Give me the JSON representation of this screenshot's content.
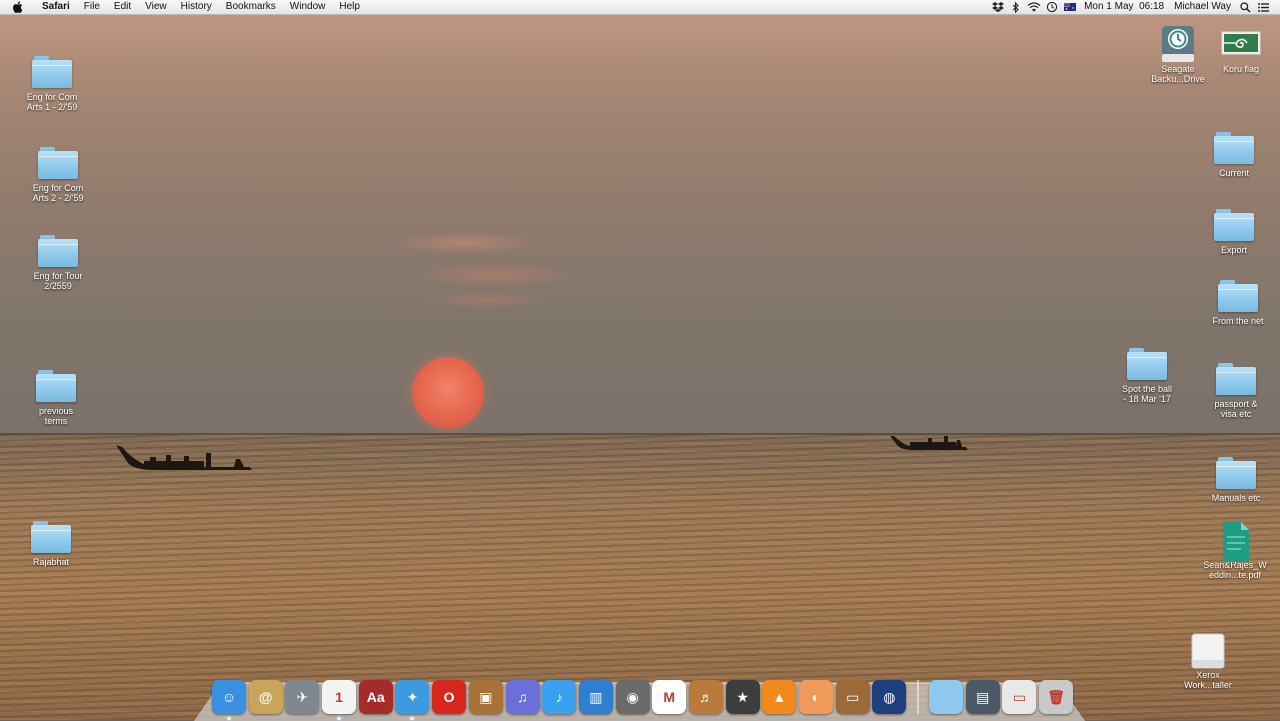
{
  "menubar": {
    "app_name": "Safari",
    "menus": [
      "File",
      "Edit",
      "View",
      "History",
      "Bookmarks",
      "Window",
      "Help"
    ],
    "clock": "Mon 1 May  06:18",
    "user": "Michael Way",
    "status_icons": [
      "dropbox-icon",
      "bluetooth-icon",
      "wifi-icon",
      "time-machine-icon",
      "flag-australia-icon"
    ]
  },
  "desktop_icons_left": [
    {
      "label": "Eng for Com\nArts 1 - 2/'59",
      "kind": "folder"
    },
    {
      "label": "Eng for Com\nArts 2 - 2/'59",
      "kind": "folder"
    },
    {
      "label": "Eng for Tour\n2/2559",
      "kind": "folder"
    },
    {
      "label": "previous\nterms",
      "kind": "folder"
    },
    {
      "label": "Rajabhat",
      "kind": "folder"
    }
  ],
  "desktop_icons_right": [
    {
      "label": "Seagate\nBacku...Drive",
      "kind": "drive"
    },
    {
      "label": "Koru flag",
      "kind": "image"
    },
    {
      "label": "Current",
      "kind": "folder"
    },
    {
      "label": "Export",
      "kind": "folder"
    },
    {
      "label": "From the net",
      "kind": "folder"
    },
    {
      "label": "Spot the ball\n- 18 Mar '17",
      "kind": "folder"
    },
    {
      "label": "passport &\nvisa etc",
      "kind": "folder"
    },
    {
      "label": "Manuals etc",
      "kind": "folder"
    },
    {
      "label": "Sean&Rajes_W\neddin...te.pdf",
      "kind": "pdf"
    },
    {
      "label": "Xerox\nWork...taller",
      "kind": "disk-image"
    }
  ],
  "dock": {
    "apps": [
      {
        "name": "finder-icon",
        "glyph": "☺",
        "color": "#3a8fe0",
        "running": true
      },
      {
        "name": "contacts-icon",
        "glyph": "@",
        "color": "#c8a45c",
        "running": false
      },
      {
        "name": "launchpad-icon",
        "glyph": "✈",
        "color": "#7f8791",
        "running": false
      },
      {
        "name": "calendar-icon",
        "glyph": "1",
        "color": "#f4f4f4",
        "running": true
      },
      {
        "name": "dictionary-icon",
        "glyph": "Aa",
        "color": "#a52b2b",
        "running": false
      },
      {
        "name": "safari-icon",
        "glyph": "✦",
        "color": "#3b9be2",
        "running": true
      },
      {
        "name": "opera-icon",
        "glyph": "O",
        "color": "#d7261e",
        "running": false
      },
      {
        "name": "iphoto-icon",
        "glyph": "▣",
        "color": "#a87238",
        "running": false
      },
      {
        "name": "itunes-icon",
        "glyph": "♫",
        "color": "#6b6fd8",
        "running": false
      },
      {
        "name": "music-icon",
        "glyph": "♪",
        "color": "#3aa0f0",
        "running": false
      },
      {
        "name": "keynote-chart-icon",
        "glyph": "▥",
        "color": "#2e7fcf",
        "running": false
      },
      {
        "name": "image-capture-icon",
        "glyph": "◉",
        "color": "#6a6a6a",
        "running": false
      },
      {
        "name": "mee-icon",
        "glyph": "M",
        "color": "#ffffff",
        "running": false
      },
      {
        "name": "garageband-icon",
        "glyph": "♬",
        "color": "#b97a3a",
        "running": false
      },
      {
        "name": "imovie-icon",
        "glyph": "★",
        "color": "#3d3d3d",
        "running": false
      },
      {
        "name": "vlc-icon",
        "glyph": "▲",
        "color": "#f08a1c",
        "running": false
      },
      {
        "name": "cantaloupe-icon",
        "glyph": "◐",
        "color": "#f09a5a",
        "running": false
      },
      {
        "name": "presentation-icon",
        "glyph": "▭",
        "color": "#9c6a3a",
        "running": false
      },
      {
        "name": "network-globe-icon",
        "glyph": "◍",
        "color": "#1f3f7f",
        "running": false
      }
    ],
    "trailing": [
      {
        "name": "applications-folder-icon",
        "glyph": "",
        "color": "#8ec8ec"
      },
      {
        "name": "documents-stack-icon",
        "glyph": "▤",
        "color": "#4b5866"
      },
      {
        "name": "downloads-stack-icon",
        "glyph": "▭",
        "color": "#e8e8e8"
      },
      {
        "name": "trash-icon",
        "glyph": "🗑",
        "color": "#c9c9c9"
      }
    ]
  }
}
